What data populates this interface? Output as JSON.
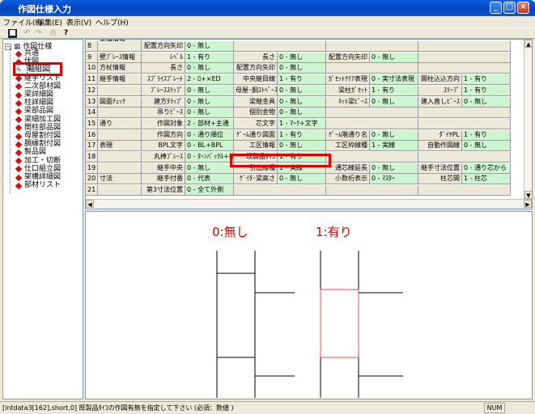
{
  "window": {
    "title": "作図仕様入力"
  },
  "menu": [
    "ファイル(F)",
    "編集(E)",
    "表示(V)",
    "ヘルプ(H)"
  ],
  "tree": {
    "root": "作図仕様",
    "items": [
      "共通",
      "伏図",
      "軸組図",
      "継手リスト",
      "二次部材図",
      "梁詳細図",
      "柱詳細図",
      "梁部品図",
      "梁細加工図",
      "間柱部品図",
      "母屋割付図",
      "胴縁割付図",
      "製品図",
      "加工・切断",
      "仕口組立図",
      "架構詳細図",
      "部材リスト"
    ],
    "selected_index": 2
  },
  "grid": {
    "rows": [
      {
        "num": "8",
        "cat": "",
        "cells": [
          [
            "配置方向矢印",
            "0 - 無し"
          ]
        ]
      },
      {
        "num": "9",
        "cat": "壁ﾌﾞﾚｰｽ情報",
        "cells": [
          [
            "ﾚﾍﾞﾙ",
            "1 - 有り"
          ],
          [
            "長さ",
            "0 - 無し"
          ],
          [
            "配置方向矢印",
            "0 - 無し"
          ]
        ]
      },
      {
        "num": "10",
        "cat": "方杖情報",
        "cells": [
          [
            "長さ",
            "0 - 無し"
          ],
          [
            "配置方向矢印",
            "0 - 無し"
          ]
        ]
      },
      {
        "num": "11",
        "cat": "継手情報",
        "cells": [
          [
            "ｽﾌﾟﾗｲｽﾌﾟﾚｰﾄ",
            "2 - ﾛ+×ED"
          ],
          [
            "中央継目線",
            "1 - 有り"
          ],
          [
            "ｶﾞｾｯﾄｸﾘｱ表現",
            "0 - 実寸法表現"
          ],
          [
            "間柱込込方向",
            "1 - 有り"
          ]
        ]
      },
      {
        "num": "12",
        "cat": "",
        "cells": [
          [
            "ﾌﾞﾚｰｽｽﾘｯﾌﾟ",
            "0 - 無し"
          ],
          [
            "母屋･胴ｽﾄﾍﾟｰｽ",
            "0 - 無し"
          ],
          [
            "梁柱ｶﾞｾｯﾄ",
            "1 - 有り"
          ],
          [
            "ｽﾘｰﾌﾞ",
            "1 - 有り"
          ]
        ]
      },
      {
        "num": "13",
        "cat": "図面ﾁｪｯｸ",
        "cells": [
          [
            "建方ﾀﾗｯﾌﾟ",
            "0 - 無し"
          ],
          [
            "梁継金具",
            "0 - 無し"
          ],
          [
            "ﾈｯﾄ梁ﾋﾟｰｽ",
            "0 - 無し"
          ],
          [
            "建入直しﾋﾟｰｽ",
            "0 - 無し"
          ]
        ]
      },
      {
        "num": "14",
        "cat": "",
        "cells": [
          [
            "吊りﾋﾟｰｽ",
            "0 - 無し"
          ],
          [
            "個別金物",
            "0 - 無し"
          ]
        ]
      },
      {
        "num": "15",
        "cat": "通り",
        "cells": [
          [
            "作図対象",
            "2 - 部材+主通"
          ],
          [
            "芯文字",
            "1 - ﾏｰｸ+文字"
          ]
        ]
      },
      {
        "num": "16",
        "cat": "",
        "cells": [
          [
            "作図方向",
            "0 - 通り順位"
          ],
          [
            "ｹﾞｰﾑ通り図面",
            "1 - 有り"
          ],
          [
            "ｹﾞｰﾑ階通り名",
            "0 - 無し"
          ],
          [
            "ﾀﾞｲﾔPL",
            "1 - 有り"
          ]
        ]
      },
      {
        "num": "17",
        "cat": "表現",
        "cells": [
          [
            "BPL文字",
            "0 - BL+BPL"
          ],
          [
            "工区情報",
            "0 - 無し"
          ],
          [
            "工区枠線種",
            "1 - 実線"
          ],
          [
            "自動作図線",
            "0 - 無し"
          ]
        ]
      },
      {
        "num": "18",
        "cat": "",
        "cells": [
          [
            "丸棒ﾌﾞﾚｰｽ",
            "0 - ﾀｰﾝﾊﾞｯｸﾙ+棒"
          ],
          [
            "既製品ﾀｲｺ",
            "1 - 有り"
          ]
        ]
      },
      {
        "num": "19",
        "cat": "",
        "cells": [
          [
            "継手中央",
            "0 - 無し"
          ],
          [
            "引出線種",
            "1 - 実線"
          ],
          [
            "通芯線延長",
            "0 - 無し"
          ],
          [
            "継手寸法位置",
            "0 - 通り芯から"
          ]
        ]
      },
      {
        "num": "20",
        "cat": "寸法",
        "cells": [
          [
            "継手付番",
            "0 - 代表"
          ],
          [
            "ｹﾞｲﾀ･梁高さ",
            "0 - 無し"
          ],
          [
            "小数桁表示",
            "0 - ﾏｽﾀｰ"
          ],
          [
            "柱芯間",
            "1 - 柱芯"
          ]
        ]
      },
      {
        "num": "21",
        "cat": "",
        "cells": [
          [
            "第3寸法位置",
            "0 - 全て外側"
          ]
        ]
      }
    ],
    "top_partial": "架構情報"
  },
  "preview": {
    "label_none": "0:無し",
    "label_yes": "1:有り"
  },
  "status": {
    "message": "[intdata3[162],short,0] 既製品ﾀｲｺの作図有無を指定して下さい (必須：数値 )",
    "num": "NUM"
  },
  "colors": {
    "highlight": "#e00000",
    "value_bg": "#cdf5d0"
  }
}
